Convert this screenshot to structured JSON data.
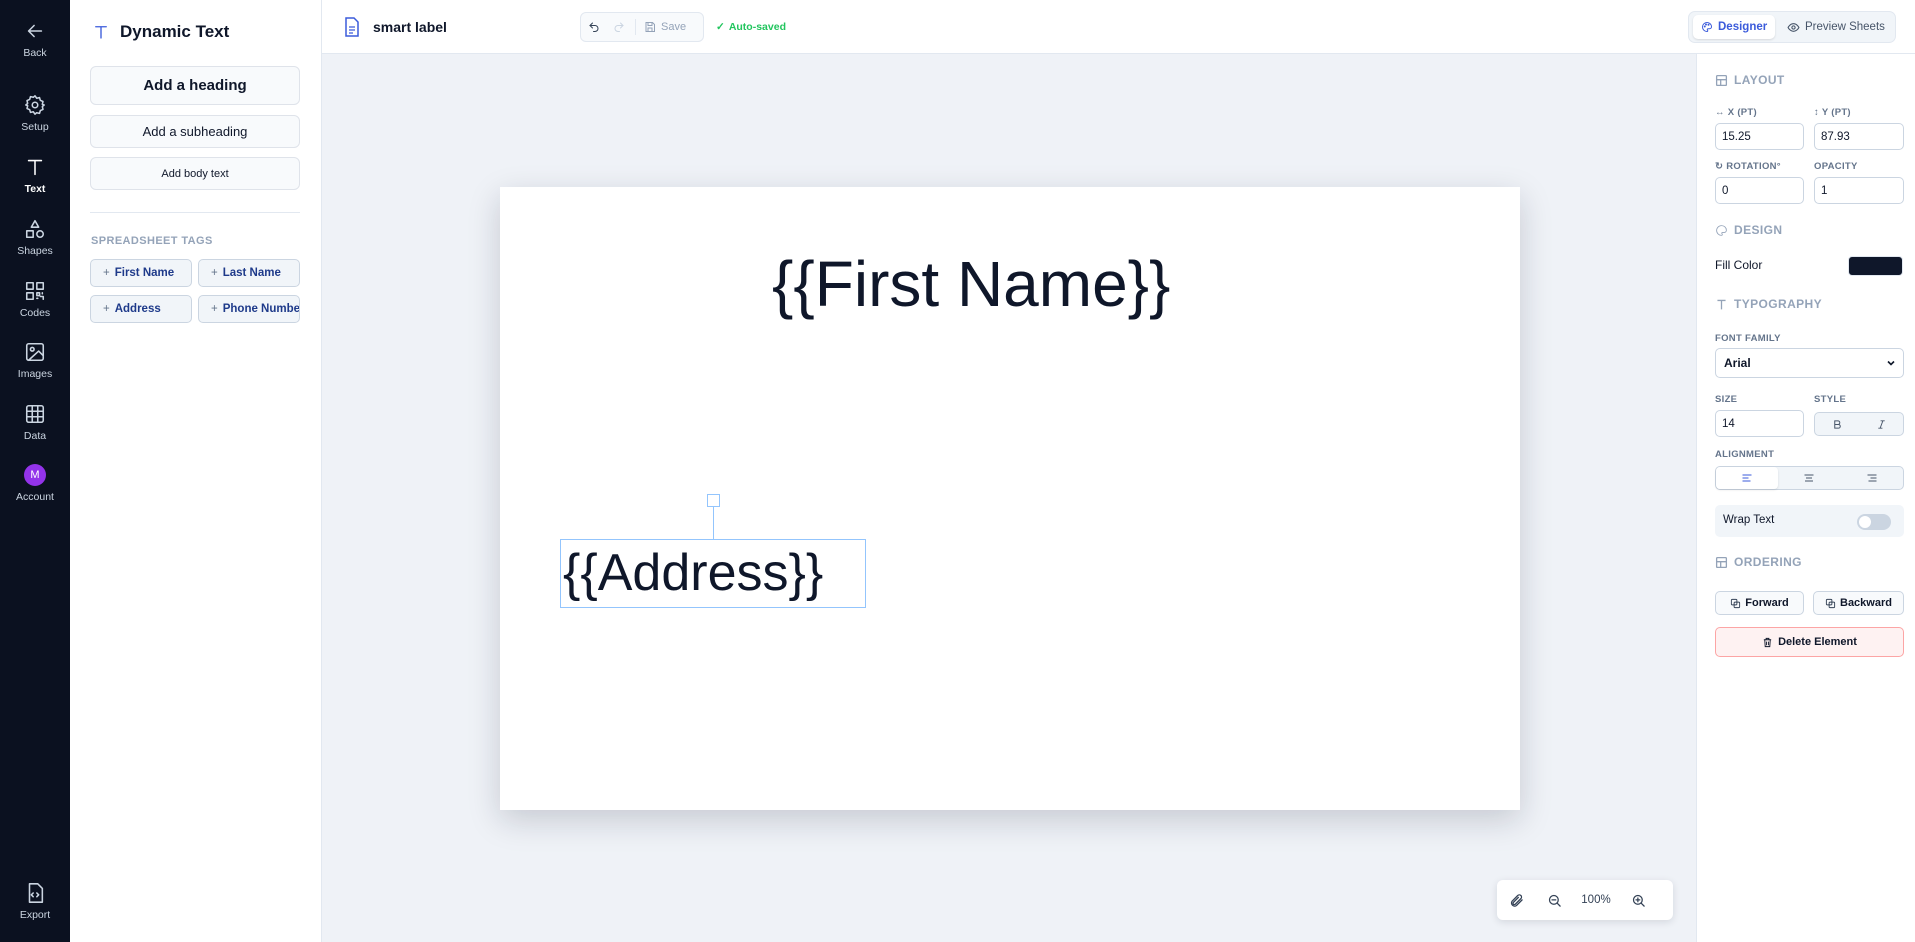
{
  "rail": {
    "back": "Back",
    "setup": "Setup",
    "text": "Text",
    "shapes": "Shapes",
    "codes": "Codes",
    "images": "Images",
    "data": "Data",
    "account": "Account",
    "avatar_initial": "M",
    "export": "Export"
  },
  "panel": {
    "title": "Dynamic Text",
    "add_heading": "Add a heading",
    "add_subheading": "Add a subheading",
    "add_body": "Add body text",
    "tags_label": "SPREADSHEET TAGS",
    "tags": [
      "First Name",
      "Last Name",
      "Address",
      "Phone Number"
    ]
  },
  "topbar": {
    "document_name": "smart label",
    "save_label": "Save",
    "autosaved_label": "Auto-saved",
    "designer_label": "Designer",
    "preview_label": "Preview Sheets"
  },
  "canvas": {
    "element_first_name": "{{First Name}}",
    "element_address": "{{Address}}",
    "zoom": "100%"
  },
  "inspector": {
    "layout_header": "LAYOUT",
    "x_label": "X (PT)",
    "x_value": "15.25",
    "y_label": "Y (PT)",
    "y_value": "87.93",
    "rotation_label": "ROTATION°",
    "rotation_value": "0",
    "opacity_label": "OPACITY",
    "opacity_value": "1",
    "design_header": "DESIGN",
    "fill_color_label": "Fill Color",
    "fill_color": "#0f172a",
    "typography_header": "TYPOGRAPHY",
    "font_family_label": "FONT FAMILY",
    "font_family_value": "Arial",
    "size_label": "SIZE",
    "size_value": "14",
    "style_label": "STYLE",
    "alignment_label": "ALIGNMENT",
    "wrap_text_label": "Wrap Text",
    "ordering_header": "ORDERING",
    "forward_label": "Forward",
    "backward_label": "Backward",
    "delete_label": "Delete Element"
  },
  "colors": {
    "accent": "#3b5bdb",
    "rail_bg": "#0b1120",
    "autosave": "#22c55e",
    "avatar": "#9333ea"
  }
}
